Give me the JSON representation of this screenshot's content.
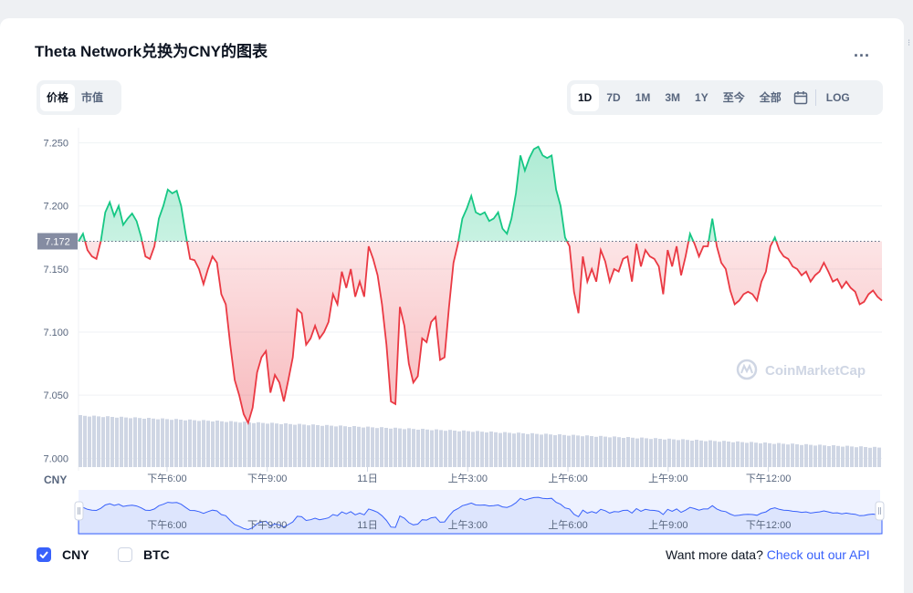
{
  "title": "Theta Network兑换为CNY的图表",
  "more_label": "...",
  "toggle": {
    "price": "价格",
    "market_cap": "市值"
  },
  "ranges": {
    "d1": "1D",
    "d7": "7D",
    "m1": "1M",
    "m3": "3M",
    "y1": "1Y",
    "ytd": "至今",
    "all": "全部",
    "log": "LOG"
  },
  "watermark": "CoinMarketCap",
  "legend": {
    "cny": "CNY",
    "btc": "BTC"
  },
  "more_data": {
    "text": "Want more data?",
    "link": "Check out our API"
  },
  "colors": {
    "up": "#16c784",
    "down": "#ea3943",
    "accent": "#3861fb",
    "volume": "#cfd6e4",
    "navigator": "#dde5fd"
  },
  "chart_data": {
    "type": "line",
    "ylabel": "CNY",
    "y_ticks": [
      "7.250",
      "7.200",
      "7.150",
      "7.100",
      "7.050",
      "7.000"
    ],
    "ylim": [
      6.993,
      7.262
    ],
    "x_ticks": [
      "下午6:00",
      "下午9:00",
      "11日",
      "上午3:00",
      "上午6:00",
      "上午9:00",
      "下午12:00"
    ],
    "navigator_ticks": [
      "下午6:00",
      "下午9:00",
      "11日",
      "上午3:00",
      "上午6:00",
      "上午9:00",
      "下午12:00"
    ],
    "reference_price": 7.172,
    "reference_label": "7.172",
    "x_hours": [
      0,
      3,
      6,
      9,
      12,
      15,
      18
    ],
    "x_range": [
      -2.65,
      21.4
    ],
    "grid": true,
    "series": [
      {
        "values": [
          7.172,
          7.178,
          7.165,
          7.16,
          7.158,
          7.172,
          7.195,
          7.203,
          7.192,
          7.2,
          7.185,
          7.19,
          7.194,
          7.188,
          7.176,
          7.16,
          7.158,
          7.168,
          7.19,
          7.2,
          7.213,
          7.21,
          7.212,
          7.2,
          7.178,
          7.158,
          7.157,
          7.15,
          7.138,
          7.15,
          7.16,
          7.155,
          7.13,
          7.122,
          7.09,
          7.062,
          7.05,
          7.035,
          7.028,
          7.04,
          7.068,
          7.08,
          7.085,
          7.052,
          7.066,
          7.06,
          7.045,
          7.062,
          7.08,
          7.118,
          7.115,
          7.09,
          7.095,
          7.105,
          7.095,
          7.1,
          7.108,
          7.13,
          7.122,
          7.148,
          7.135,
          7.15,
          7.128,
          7.14,
          7.128,
          7.168,
          7.158,
          7.145,
          7.122,
          7.09,
          7.045,
          7.043,
          7.12,
          7.105,
          7.075,
          7.06,
          7.065,
          7.095,
          7.092,
          7.108,
          7.112,
          7.078,
          7.08,
          7.12,
          7.155,
          7.17,
          7.19,
          7.198,
          7.208,
          7.195,
          7.193,
          7.195,
          7.188,
          7.19,
          7.195,
          7.182,
          7.178,
          7.19,
          7.21,
          7.24,
          7.228,
          7.238,
          7.245,
          7.247,
          7.24,
          7.238,
          7.24,
          7.213,
          7.2,
          7.175,
          7.168,
          7.132,
          7.115,
          7.16,
          7.14,
          7.15,
          7.14,
          7.165,
          7.156,
          7.14,
          7.15,
          7.148,
          7.158,
          7.16,
          7.14,
          7.17,
          7.152,
          7.165,
          7.16,
          7.158,
          7.152,
          7.13,
          7.165,
          7.152,
          7.168,
          7.145,
          7.16,
          7.178,
          7.17,
          7.16,
          7.168,
          7.168,
          7.19,
          7.168,
          7.155,
          7.15,
          7.133,
          7.122,
          7.125,
          7.13,
          7.132,
          7.13,
          7.125,
          7.14,
          7.148,
          7.168,
          7.175,
          7.165,
          7.16,
          7.158,
          7.152,
          7.15,
          7.145,
          7.148,
          7.14,
          7.145,
          7.148,
          7.155,
          7.148,
          7.14,
          7.142,
          7.135,
          7.14,
          7.135,
          7.132,
          7.122,
          7.124,
          7.13,
          7.133,
          7.128,
          7.125
        ]
      }
    ]
  }
}
